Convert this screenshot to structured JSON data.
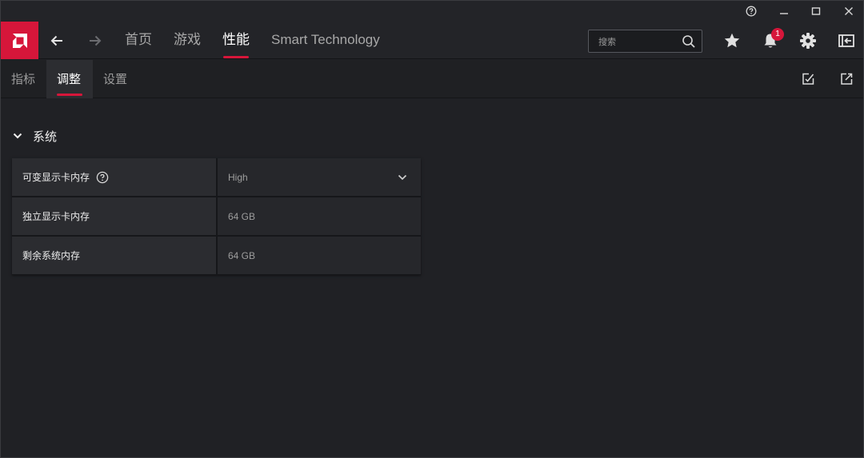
{
  "window_controls": {
    "help": "help-circle-icon",
    "minimize": "minimize-icon",
    "maximize": "maximize-icon",
    "close": "close-icon"
  },
  "header": {
    "logo": "amd-logo",
    "tabs": [
      {
        "label": "首页",
        "active": false
      },
      {
        "label": "游戏",
        "active": false
      },
      {
        "label": "性能",
        "active": true
      },
      {
        "label": "Smart Technology",
        "active": false
      }
    ],
    "search": {
      "placeholder": "搜索"
    },
    "notification_count": "1"
  },
  "subtabs": [
    {
      "label": "指标",
      "active": false
    },
    {
      "label": "调整",
      "active": true
    },
    {
      "label": "设置",
      "active": false
    }
  ],
  "section": {
    "title": "系统",
    "rows": [
      {
        "label": "可变显示卡内存",
        "value": "High",
        "has_help": true,
        "has_dropdown": true
      },
      {
        "label": "独立显示卡内存",
        "value": "64 GB"
      },
      {
        "label": "剩余系统内存",
        "value": "64 GB"
      }
    ]
  },
  "colors": {
    "accent": "#d6163a",
    "background": "#202125",
    "header": "#232428"
  }
}
